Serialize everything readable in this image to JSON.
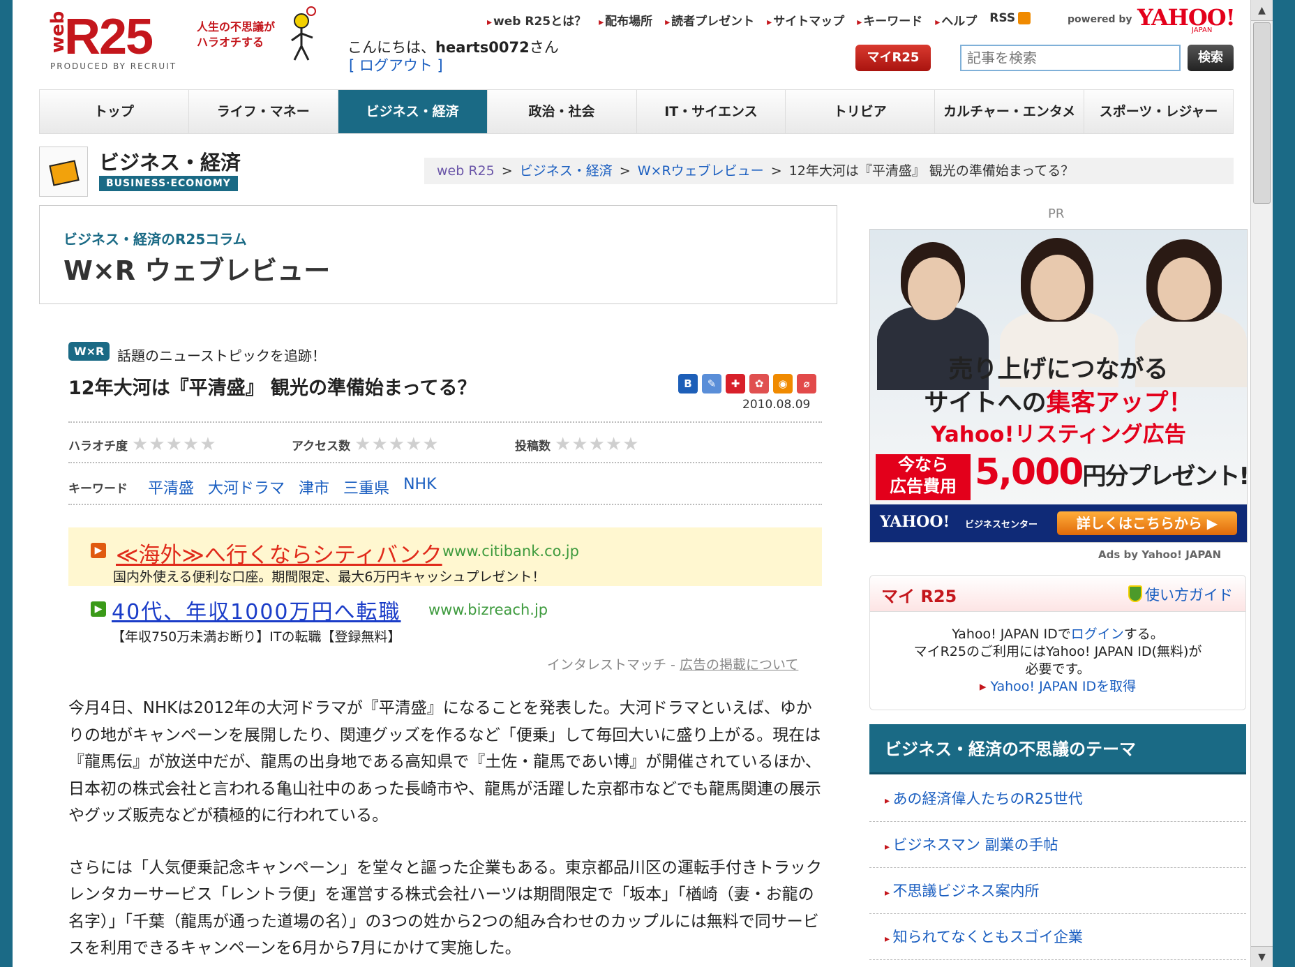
{
  "header": {
    "logo_web": "web",
    "logo_r25": "R25",
    "logo_tagline_1": "人生の不思議が",
    "logo_tagline_2": "ハラオチする",
    "logo_produced": "PRODUCED BY RECRUIT",
    "top_links": [
      "web R25とは？",
      "配布場所",
      "読者プレゼント",
      "サイトマップ",
      "キーワード",
      "ヘルプ"
    ],
    "rss_label": "RSS",
    "powered_by": "powered by",
    "yahoo_logo": "YAHOO!",
    "yahoo_japan": "JAPAN",
    "greeting_prefix": "こんにちは、",
    "username": "hearts0072",
    "greeting_suffix": "さん",
    "logout_label": "[ ログアウト ]",
    "myr25_button": "マイR25",
    "search_placeholder": "記事を検索",
    "search_button": "検索"
  },
  "category_nav": [
    {
      "label": "トップ",
      "active": false
    },
    {
      "label": "ライフ・マネー",
      "active": false
    },
    {
      "label": "ビジネス・経済",
      "active": true
    },
    {
      "label": "政治・社会",
      "active": false
    },
    {
      "label": "IT・サイエンス",
      "active": false
    },
    {
      "label": "トリビア",
      "active": false
    },
    {
      "label": "カルチャー・エンタメ",
      "active": false
    },
    {
      "label": "スポーツ・レジャー",
      "active": false
    }
  ],
  "section": {
    "title": "ビジネス・経済",
    "subtitle": "BUSINESS·ECONOMY"
  },
  "breadcrumb": {
    "home": "web R25",
    "level1": "ビジネス・経済",
    "level2": "W×Rウェブレビュー",
    "current": "12年大河は『平清盛』 観光の準備始まってる？",
    "sep": ">"
  },
  "column": {
    "label": "ビジネス・経済のR25コラム",
    "title": "W×R ウェブレビュー"
  },
  "article": {
    "badge": "W×R",
    "tagline": "話題のニューストピックを追跡！",
    "headline": "12年大河は『平清盛』 観光の準備始まってる？",
    "date": "2010.08.09",
    "ratings": [
      {
        "label": "ハラオチ度",
        "stars": "★★★★★",
        "value": 0
      },
      {
        "label": "アクセス数",
        "stars": "★★★★★",
        "value": 0
      },
      {
        "label": "投稿数",
        "stars": "★★★★★",
        "value": 0
      }
    ],
    "keyword_label": "キーワード",
    "keywords": [
      "平清盛",
      "大河ドラマ",
      "津市",
      "三重県",
      "NHK"
    ],
    "paragraphs": [
      "今月4日、NHKは2012年の大河ドラマが『平清盛』になることを発表した。大河ドラマといえば、ゆかりの地がキャンペーンを展開したり、関連グッズを作るなど「便乗」して毎回大いに盛り上がる。現在は『龍馬伝』が放送中だが、龍馬の出身地である高知県で『土佐・龍馬であい博』が開催されているほか、日本初の株式会社と言われる亀山社中のあった長崎市や、龍馬が活躍した京都市などでも龍馬関連の展示やグッズ販売などが積極的に行われている。",
      "さらには「人気便乗記念キャンペーン」を堂々と謳った企業もある。東京都品川区の運転手付きトラックレンタカーサービス「レントラ便」を運営する株式会社ハーツは期間限定で「坂本」「楢崎（妻・お龍の名字）」「千葉（龍馬が通った道場の名）」の3つの姓から2つの組み合わせのカップルには無料で同サービスを利用できるキャンペーンを6月から7月にかけて実施した。"
    ]
  },
  "share_icons": [
    {
      "name": "hatena-bookmark-icon",
      "glyph": "B",
      "color": "#1d5fb8"
    },
    {
      "name": "clip-icon",
      "glyph": "✎",
      "color": "#5a8ed8"
    },
    {
      "name": "buzzurl-icon",
      "glyph": "✚",
      "color": "#d8202a"
    },
    {
      "name": "livedoor-clip-icon",
      "glyph": "✿",
      "color": "#e05050"
    },
    {
      "name": "rss-feed-icon",
      "glyph": "◉",
      "color": "#f08a00"
    },
    {
      "name": "attach-icon",
      "glyph": "⌀",
      "color": "#e24a4a"
    }
  ],
  "ads": {
    "ad1": {
      "title": "≪海外≫へ行くならシティバンク",
      "url": "www.citibank.co.jp",
      "desc": "国内外使える便利な口座。期間限定、最大6万円キャッシュプレゼント！"
    },
    "ad2": {
      "title": "40代、年収1000万円へ転職",
      "url": "www.bizreach.jp",
      "desc": "【年収750万未満お断り】ITの転職【登録無料】"
    },
    "credit_text": "インタレストマッチ - ",
    "credit_link": "広告の掲載について"
  },
  "sidebar": {
    "pr_label": "PR",
    "banner": {
      "line1": "売り上げにつながる",
      "line2_a": "サイトへの",
      "line2_b": "集客アップ！",
      "line3": "Yahoo!リスティング広告",
      "red_box_1": "今なら",
      "red_box_2": "広告費用",
      "amount": "5,000",
      "amount_suffix": "円分プレゼント!",
      "bottom_logo": "YAHOO!",
      "bottom_center": "ビジネスセンター",
      "cta": "詳しくはこちらから ▶"
    },
    "ads_by": "Ads by Yahoo! JAPAN",
    "myr25": {
      "title": "マイ R25",
      "guide": "使い方ガイド",
      "line1_a": "Yahoo! JAPAN IDで",
      "line1_link": "ログイン",
      "line1_b": "する。",
      "line2": "マイR25のご利用にはYahoo! JAPAN ID(無料)が",
      "line3": "必要です。",
      "get_id": "Yahoo! JAPAN IDを取得"
    },
    "theme_title": "ビジネス・経済の不思議のテーマ",
    "themes": [
      "あの経済偉人たちのR25世代",
      "ビジネスマン 副業の手帖",
      "不思議ビジネス案内所",
      "知られてなくともスゴイ企業"
    ]
  },
  "colors": {
    "brand_red": "#c4161c",
    "nav_teal": "#1a6a85",
    "link_blue": "#1a5ec0",
    "yahoo_red": "#e3001b"
  }
}
